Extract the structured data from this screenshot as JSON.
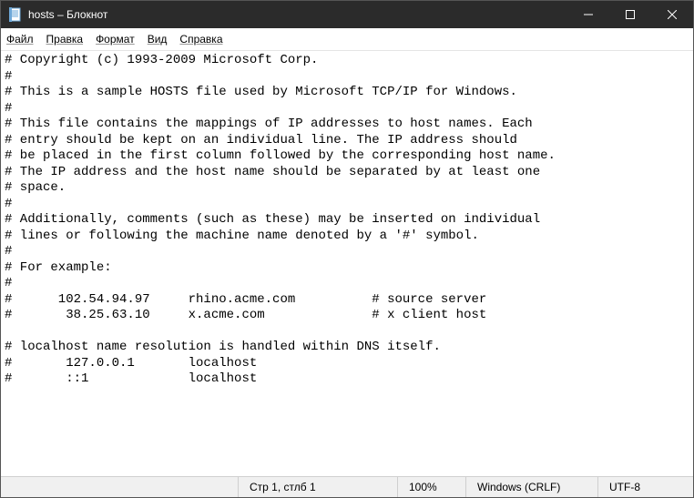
{
  "window": {
    "title": "hosts – Блокнот"
  },
  "menu": {
    "file": "Файл",
    "edit": "Правка",
    "format": "Формат",
    "view": "Вид",
    "help": "Справка"
  },
  "content": "# Copyright (c) 1993-2009 Microsoft Corp.\n#\n# This is a sample HOSTS file used by Microsoft TCP/IP for Windows.\n#\n# This file contains the mappings of IP addresses to host names. Each\n# entry should be kept on an individual line. The IP address should\n# be placed in the first column followed by the corresponding host name.\n# The IP address and the host name should be separated by at least one\n# space.\n#\n# Additionally, comments (such as these) may be inserted on individual\n# lines or following the machine name denoted by a '#' symbol.\n#\n# For example:\n#\n#      102.54.94.97     rhino.acme.com          # source server\n#       38.25.63.10     x.acme.com              # x client host\n\n# localhost name resolution is handled within DNS itself.\n#       127.0.0.1       localhost\n#       ::1             localhost",
  "status": {
    "position": "Стр 1, стлб 1",
    "zoom": "100%",
    "line_ending": "Windows (CRLF)",
    "encoding": "UTF-8"
  }
}
